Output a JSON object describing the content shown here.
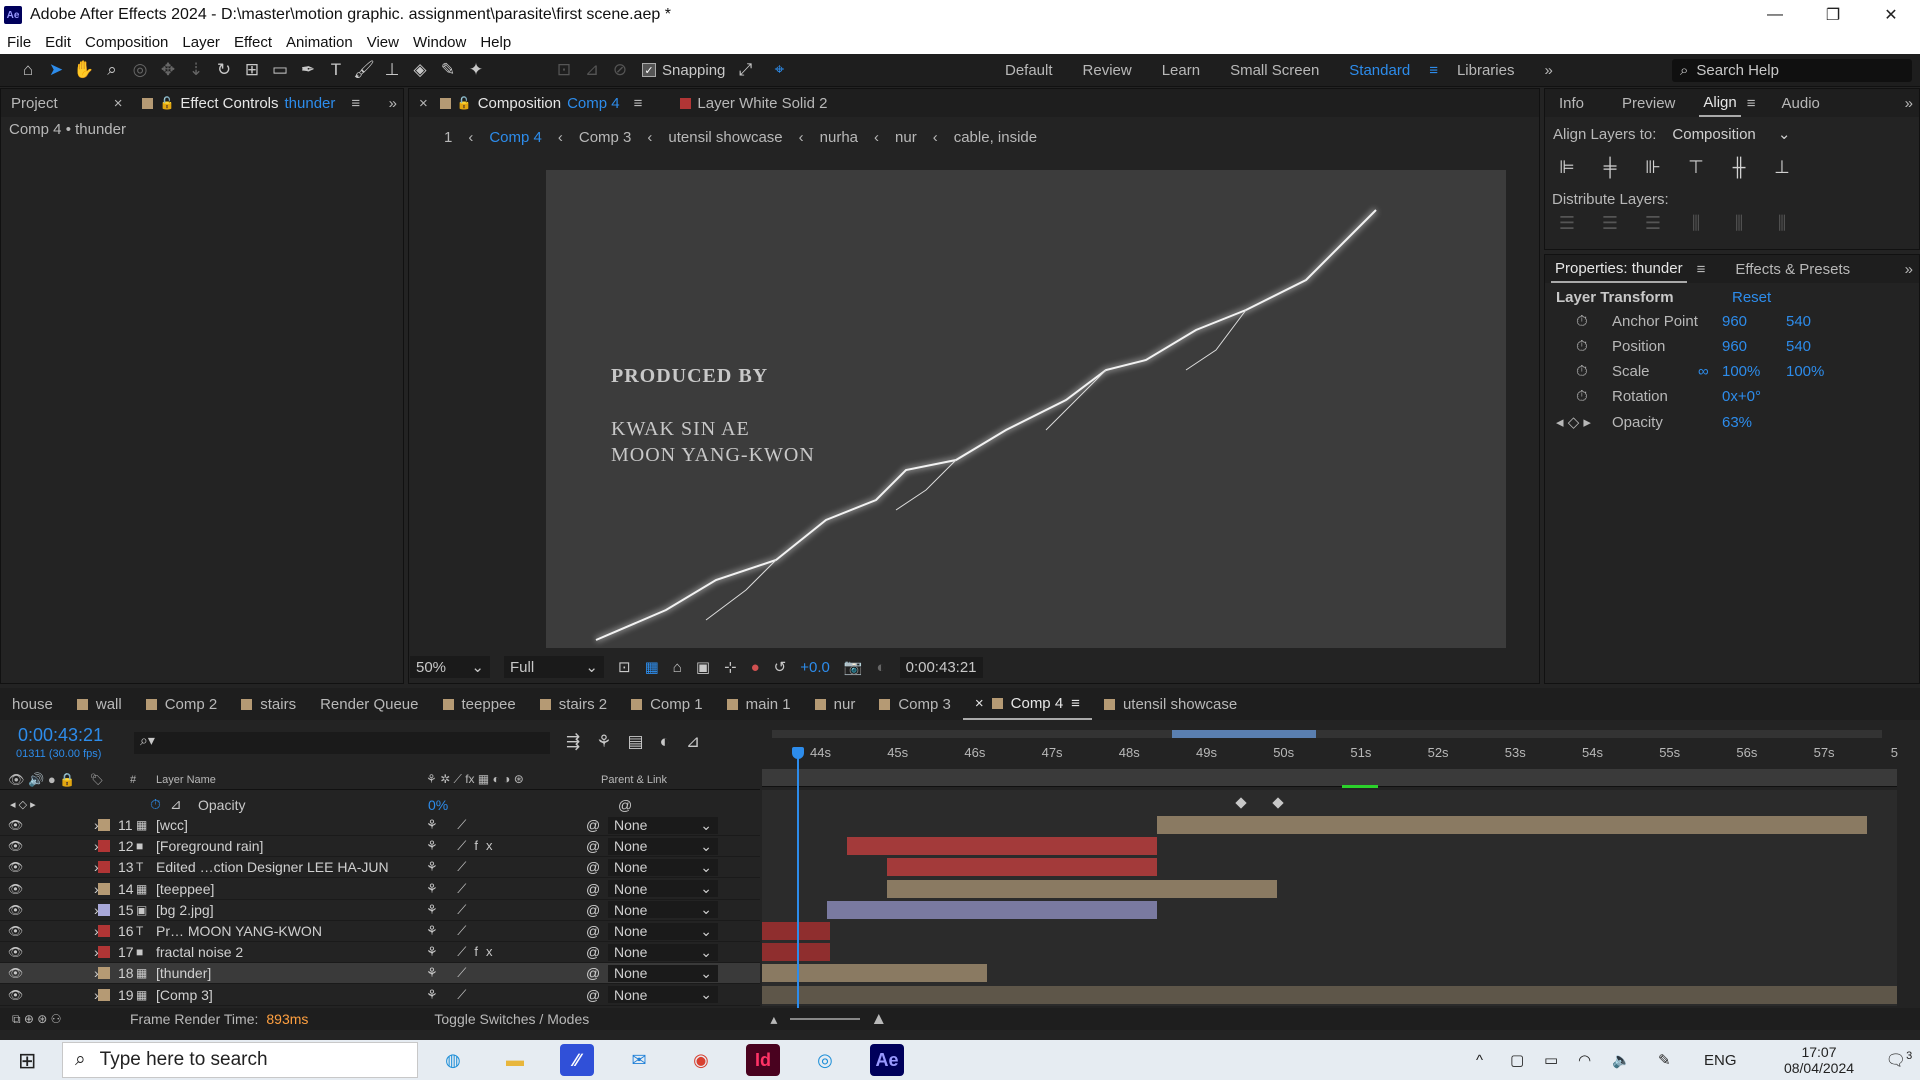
{
  "window": {
    "title": "Adobe After Effects 2024 - D:\\master\\motion graphic. assignment\\parasite\\first scene.aep *",
    "app_badge": "Ae",
    "min": "—",
    "max": "❐",
    "close": "✕"
  },
  "menu": [
    "File",
    "Edit",
    "Composition",
    "Layer",
    "Effect",
    "Animation",
    "View",
    "Window",
    "Help"
  ],
  "toolbar": {
    "snapping_label": "Snapping",
    "snapping_checked": "✓"
  },
  "workspaces": [
    "Default",
    "Review",
    "Learn",
    "Small Screen",
    "Standard",
    "Libraries"
  ],
  "search_help": {
    "placeholder": "Search Help"
  },
  "left_panel": {
    "tab_project": "Project",
    "tab_effect_controls": "Effect Controls",
    "effect_controls_layer": "thunder",
    "subtitle": "Comp 4 • thunder"
  },
  "comp_panel": {
    "tab_prefix": "Composition",
    "tab_comp": "Comp 4",
    "layer_tab": "Layer  White Solid 2",
    "breadcrumb_index": "1",
    "breadcrumbs": [
      "Comp 4",
      "Comp 3",
      "utensil showcase",
      "nurha",
      "nur",
      "cable, inside"
    ],
    "text_produced": "PRODUCED BY",
    "text_name1": "KWAK SIN AE",
    "text_name2": "MOON YANG-KWON",
    "zoom": "50%",
    "resolution": "Full",
    "exposure": "+0.0",
    "timecode": "0:00:43:21"
  },
  "right_top": {
    "tabs": [
      "Info",
      "Preview",
      "Align",
      "Audio"
    ],
    "align_to_label": "Align Layers to:",
    "align_to_value": "Composition",
    "distribute_label": "Distribute Layers:"
  },
  "properties": {
    "tab_properties": "Properties: thunder",
    "tab_effects": "Effects & Presets",
    "section": "Layer Transform",
    "reset": "Reset",
    "anchor_label": "Anchor Point",
    "anchor_x": "960",
    "anchor_y": "540",
    "position_label": "Position",
    "position_x": "960",
    "position_y": "540",
    "scale_label": "Scale",
    "scale_x": "100%",
    "scale_y": "100%",
    "rotation_label": "Rotation",
    "rotation": "0x+0°",
    "opacity_label": "Opacity",
    "opacity": "63%"
  },
  "timeline_tabs": [
    "house",
    "wall",
    "Comp 2",
    "stairs",
    "Render Queue",
    "teeppee",
    "stairs 2",
    "Comp 1",
    "main 1",
    "nur",
    "Comp 3",
    "Comp 4",
    "utensil showcase"
  ],
  "timeline": {
    "timecode": "0:00:43:21",
    "frames": "01311 (30.00 fps)",
    "col_num": "#",
    "col_layer": "Layer Name",
    "col_parent": "Parent & Link",
    "opacity_row_label": "Opacity",
    "opacity_row_value": "0%",
    "ruler": [
      "44s",
      "45s",
      "46s",
      "47s",
      "48s",
      "49s",
      "50s",
      "51s",
      "52s",
      "53s",
      "54s",
      "55s",
      "56s",
      "57s",
      "5"
    ],
    "frame_render_label": "Frame Render Time:",
    "frame_render_value": "893ms",
    "toggle_label": "Toggle Switches / Modes"
  },
  "layers": [
    {
      "num": "11",
      "name": "[wcc]",
      "type": "comp",
      "color": "#b59a74",
      "parent": "None",
      "fx": ""
    },
    {
      "num": "12",
      "name": "[Foreground rain]",
      "type": "solid",
      "color": "#b03535",
      "parent": "None",
      "fx": "fx"
    },
    {
      "num": "13",
      "name": "Edited …ction Designer  LEE HA-JUN",
      "type": "text",
      "color": "#b03535",
      "parent": "None",
      "fx": ""
    },
    {
      "num": "14",
      "name": "[teeppee]",
      "type": "comp",
      "color": "#b59a74",
      "parent": "None",
      "fx": ""
    },
    {
      "num": "15",
      "name": "[bg 2.jpg]",
      "type": "image",
      "color": "#a8a8d8",
      "parent": "None",
      "fx": ""
    },
    {
      "num": "16",
      "name": "Pr…              MOON YANG-KWON",
      "type": "text",
      "color": "#b03535",
      "parent": "None",
      "fx": ""
    },
    {
      "num": "17",
      "name": "fractal noise 2",
      "type": "solid",
      "color": "#b03535",
      "parent": "None",
      "fx": "fx"
    },
    {
      "num": "18",
      "name": "[thunder]",
      "type": "comp",
      "color": "#b59a74",
      "parent": "None",
      "fx": ""
    },
    {
      "num": "19",
      "name": "[Comp 3]",
      "type": "comp",
      "color": "#b59a74",
      "parent": "None",
      "fx": ""
    }
  ],
  "taskbar": {
    "search_placeholder": "Type here to search",
    "lang": "ENG",
    "time": "17:07",
    "date": "08/04/2024",
    "notif": "3",
    "indesign": "Id",
    "ae": "Ae"
  }
}
